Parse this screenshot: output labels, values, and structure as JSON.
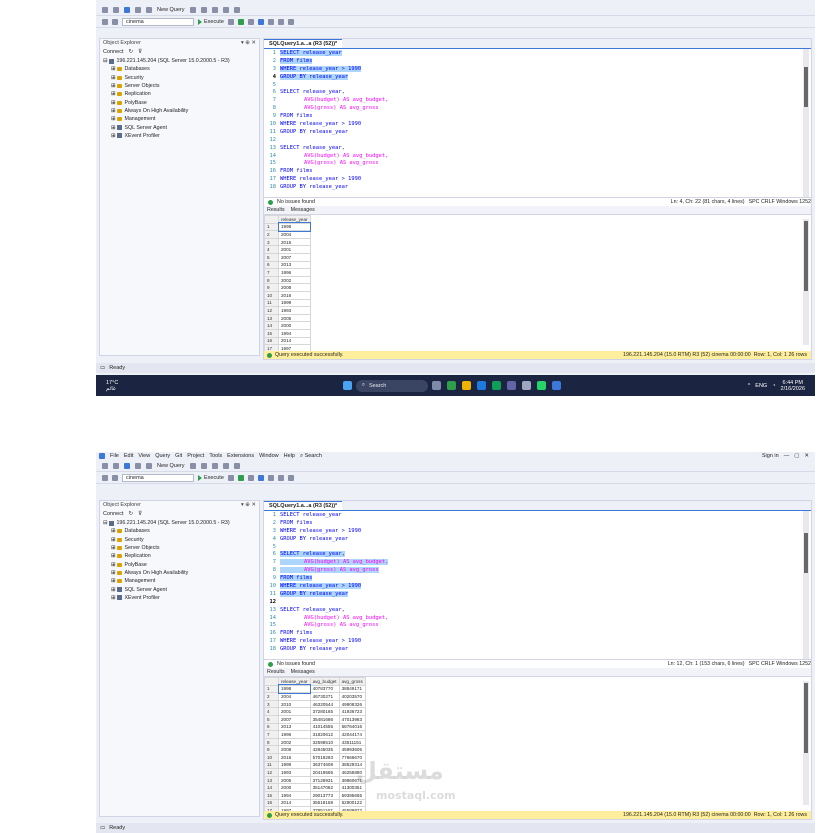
{
  "menu": {
    "items": [
      "File",
      "Edit",
      "View",
      "Query",
      "Git",
      "Project",
      "Tools",
      "Extensions",
      "Window",
      "Help"
    ],
    "search_label": "Search",
    "signin_label": "Sign in"
  },
  "toolbar": {
    "new_query_label": "New Query",
    "database": "cinema",
    "execute_label": "Execute"
  },
  "object_explorer": {
    "title": "Object Explorer",
    "connect_label": "Connect",
    "server": "196.221.145.204 (SQL Server 15.0.2000.5 - R3)",
    "nodes": [
      "Databases",
      "Security",
      "Server Objects",
      "Replication",
      "PolyBase",
      "Always On High Availability",
      "Management",
      "SQL Server Agent",
      "XEvent Profiler"
    ]
  },
  "editor_tab": "SQLQuery1.a...a (R3 (52))*",
  "code": {
    "line_numbers": [
      "1",
      "2",
      "3",
      "4",
      "5",
      "6",
      "7",
      "8",
      "9",
      "10",
      "11",
      "12",
      "13",
      "14",
      "15",
      "16",
      "17",
      "18"
    ],
    "select_release_year": "SELECT release_year",
    "select_release_year_comma": "SELECT release_year,",
    "from_films": "FROM films",
    "where_1990": "WHERE release_year > 1990",
    "group_by": "GROUP BY release_year",
    "avg_budget": "AVG(budget) AS avg_budget,",
    "avg_gross": "AVG(gross) AS avg_gross"
  },
  "status": {
    "issues": "No issues found",
    "encoding": "SPC  CRLF  Windows 1252",
    "position_top": "Ln: 4, Ch: 22   (81 chars, 4 lines)",
    "position_bottom": "Ln: 12, Ch: 1   (153 chars, 6 lines)"
  },
  "results_tabs": {
    "results_label": "Results",
    "messages_label": "Messages"
  },
  "grid_top": {
    "columns": [
      "release_year"
    ],
    "rows": [
      "1998",
      "2004",
      "2015",
      "2001",
      "2007",
      "2013",
      "1996",
      "2002",
      "2008",
      "2016",
      "1999",
      "1993",
      "2005",
      "2000",
      "1994",
      "2014",
      "1997"
    ]
  },
  "grid_bottom": {
    "columns": [
      "release_year",
      "avg_budget",
      "avg_gross"
    ],
    "rows": [
      [
        "1998",
        "40783770",
        "38849171"
      ],
      [
        "2004",
        "46730271",
        "40203570"
      ],
      [
        "2010",
        "46320544",
        "49908326"
      ],
      [
        "2001",
        "37280165",
        "41936723"
      ],
      [
        "2007",
        "35481686",
        "47013983"
      ],
      [
        "2013",
        "41014555",
        "58764016"
      ],
      [
        "1996",
        "31820612",
        "42044174"
      ],
      [
        "2002",
        "32598510",
        "43511151"
      ],
      [
        "2008",
        "42845035",
        "45993605"
      ],
      [
        "2016",
        "57019293",
        "77666670"
      ],
      [
        "1999",
        "36374608",
        "38529314"
      ],
      [
        "1993",
        "20419565",
        "46255880"
      ],
      [
        "2005",
        "37126931",
        "39860671"
      ],
      [
        "2000",
        "35147082",
        "41300351"
      ],
      [
        "1994",
        "29013773",
        "59395665"
      ],
      [
        "2014",
        "35518168",
        "62900122"
      ],
      [
        "1997",
        "37851167",
        "45589972"
      ]
    ]
  },
  "query_status": {
    "message": "Query executed successfully.",
    "details": "196.221.145.204 (15.0 RTM)   R3 (52)   cinema   00:00:00",
    "rows_top": "Row: 1, Col: 1   26 rows",
    "rows_bottom": "Row: 1, Col: 1   26 rows"
  },
  "ready_label": "Ready",
  "taskbar": {
    "weather": "17°C",
    "weather_sub": "غائم",
    "search_label": "Search",
    "lang": "ENG",
    "time": "6:44 PM",
    "date": "2/16/2026"
  },
  "watermark": {
    "arabic": "مستقل",
    "latin": "mostaql.com"
  },
  "colors": {
    "selection": "#add6ff",
    "keyword": "#0000ff",
    "function": "#ff00ff",
    "status_yellow": "#ffef9c",
    "taskbar": "#1b2440"
  }
}
